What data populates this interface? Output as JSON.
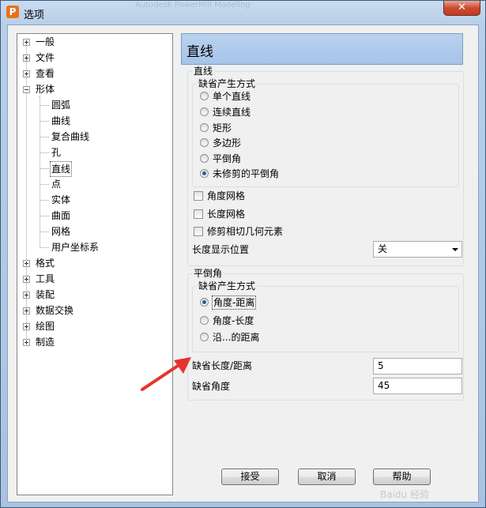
{
  "window": {
    "title": "选项",
    "app_icon_letter": "P",
    "background_title": "Autodesk PowerMill Modeling",
    "close_glyph": "✕"
  },
  "tree": {
    "items": [
      {
        "label": "一般",
        "expander": "plus"
      },
      {
        "label": "文件",
        "expander": "plus"
      },
      {
        "label": "查看",
        "expander": "plus"
      },
      {
        "label": "形体",
        "expander": "minus"
      },
      {
        "label": "圆弧",
        "child": true
      },
      {
        "label": "曲线",
        "child": true
      },
      {
        "label": "复合曲线",
        "child": true
      },
      {
        "label": "孔",
        "child": true
      },
      {
        "label": "直线",
        "child": true,
        "selected": true
      },
      {
        "label": "点",
        "child": true
      },
      {
        "label": "实体",
        "child": true
      },
      {
        "label": "曲面",
        "child": true
      },
      {
        "label": "网格",
        "child": true
      },
      {
        "label": "用户坐标系",
        "child": true
      },
      {
        "label": "格式",
        "expander": "plus"
      },
      {
        "label": "工具",
        "expander": "plus"
      },
      {
        "label": "装配",
        "expander": "plus"
      },
      {
        "label": "数据交换",
        "expander": "plus"
      },
      {
        "label": "绘图",
        "expander": "plus"
      },
      {
        "label": "制造",
        "expander": "plus"
      }
    ]
  },
  "panel": {
    "title": "直线",
    "line_group": {
      "label": "直线",
      "creation_group": {
        "label": "缺省产生方式",
        "options": [
          {
            "label": "单个直线",
            "selected": false
          },
          {
            "label": "连续直线",
            "selected": false
          },
          {
            "label": "矩形",
            "selected": false
          },
          {
            "label": "多边形",
            "selected": false
          },
          {
            "label": "平倒角",
            "selected": false
          },
          {
            "label": "未修剪的平倒角",
            "selected": true
          }
        ]
      },
      "checkboxes": [
        {
          "label": "角度网格",
          "checked": false
        },
        {
          "label": "长度网格",
          "checked": false
        },
        {
          "label": "修剪相切几何元素",
          "checked": false
        }
      ],
      "length_display": {
        "label": "长度显示位置",
        "value": "关"
      }
    },
    "chamfer_group": {
      "label": "平倒角",
      "creation_group": {
        "label": "缺省产生方式",
        "options": [
          {
            "label": "角度-距离",
            "selected": true
          },
          {
            "label": "角度-长度",
            "selected": false
          },
          {
            "label": "沿...的距离",
            "selected": false
          }
        ]
      },
      "default_length": {
        "label": "缺省长度/距离",
        "value": "5"
      },
      "default_angle": {
        "label": "缺省角度",
        "value": "45"
      }
    }
  },
  "buttons": {
    "accept": "接受",
    "cancel": "取消",
    "help": "帮助"
  },
  "watermark": "Baidu 经验",
  "colors": {
    "arrow": "#e8322d",
    "radio_dot": "#2a5fa4",
    "panel_header": "#a6c4e8"
  }
}
